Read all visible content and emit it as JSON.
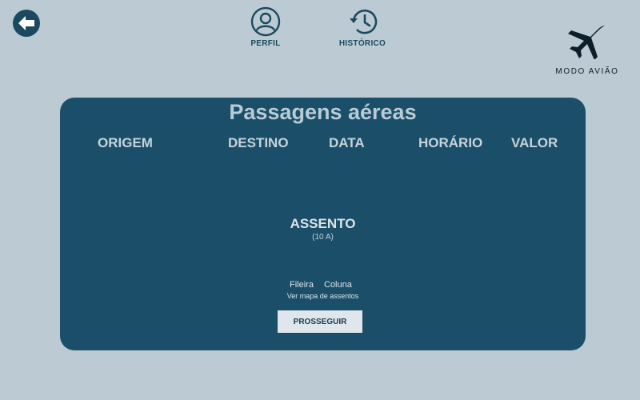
{
  "header": {
    "back_icon": "arrow-left-circle-icon",
    "profile": {
      "label": "PERFIL",
      "icon": "user-circle-icon"
    },
    "history": {
      "label": "HISTÓRICO",
      "icon": "history-clock-icon"
    }
  },
  "brand": {
    "name": "MODO AVIÃO",
    "icon": "airplane-icon"
  },
  "card": {
    "title": "Passagens aéreas",
    "columns": [
      "ORIGEM",
      "DESTINO",
      "DATA",
      "HORÁRIO",
      "VALOR"
    ],
    "seat": {
      "title": "ASSENTO",
      "value": "(10 A)",
      "row_label": "Fileira",
      "column_label": "Coluna",
      "map_link": "Ver mapa de assentos"
    },
    "proceed_label": "PROSSEGUIR"
  },
  "colors": {
    "background": "#bccbd3",
    "card": "#1b4f69",
    "accent": "#1b4a60",
    "button": "#dfe7ec"
  }
}
